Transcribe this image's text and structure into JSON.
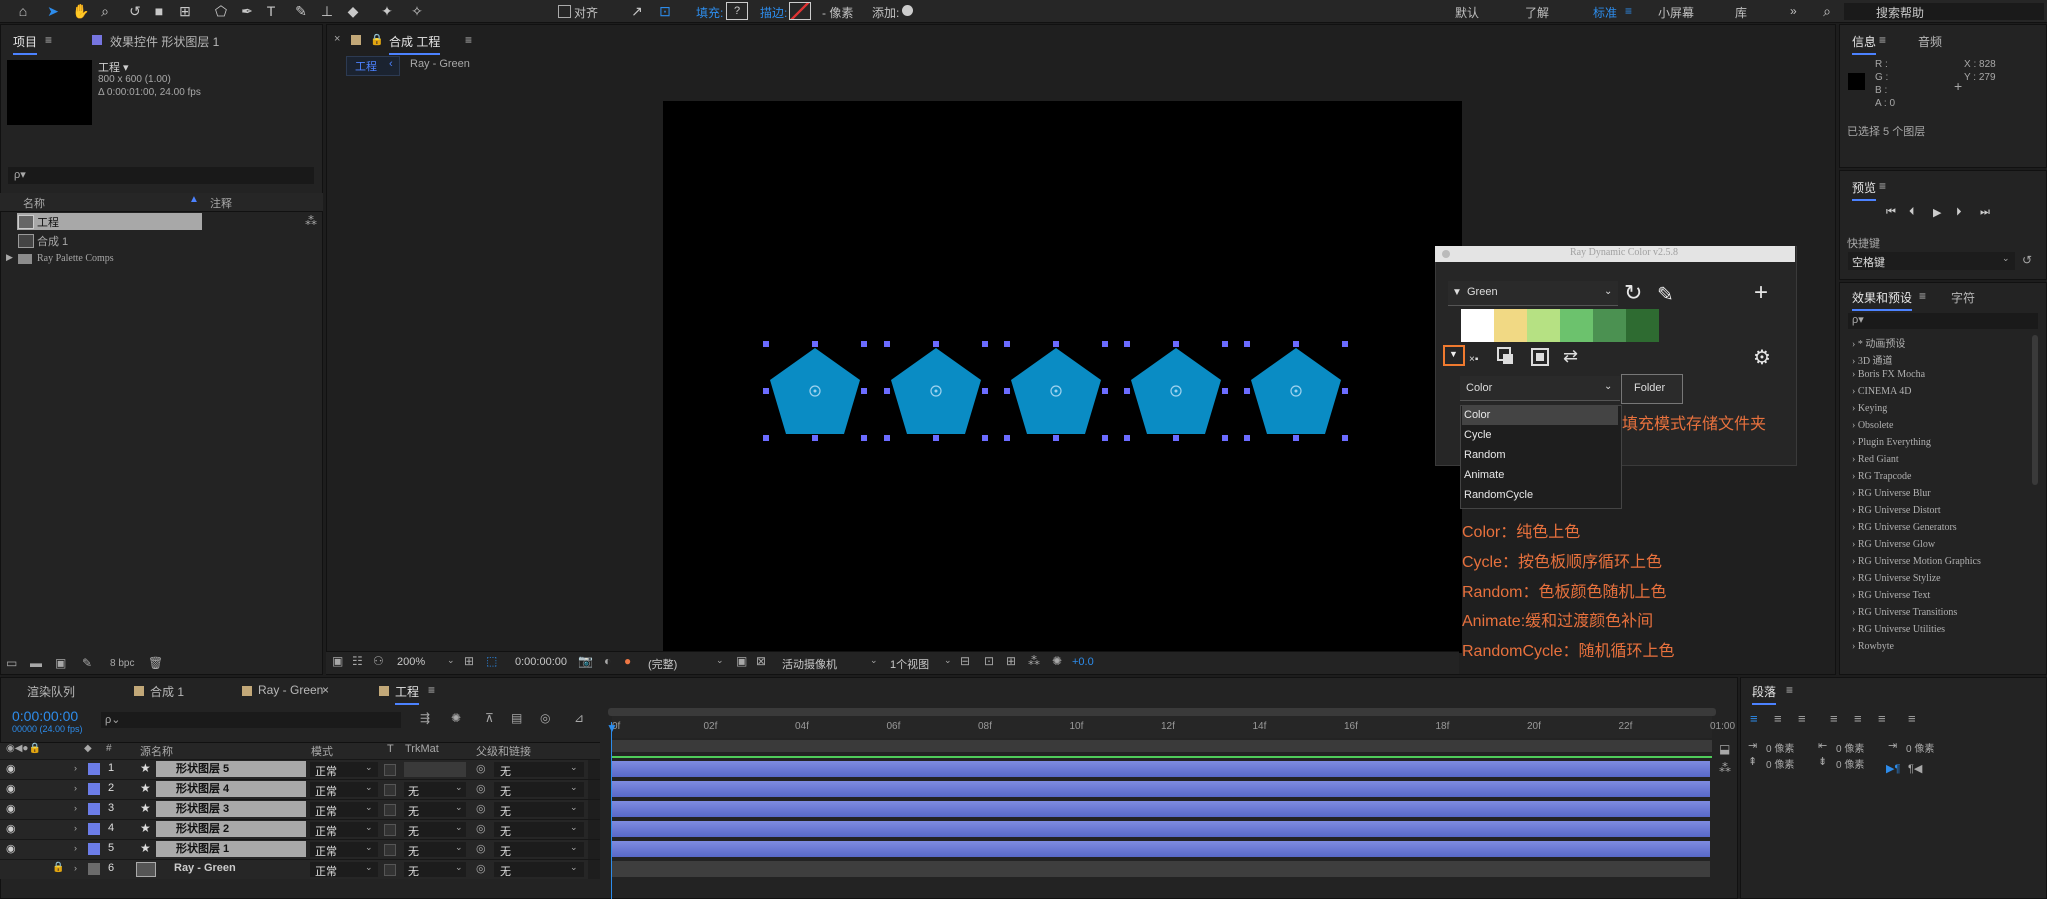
{
  "toolbar": {
    "align_label": "对齐",
    "fill_label": "填充:",
    "fill_value": "?",
    "stroke_label": "描边:",
    "stroke_unit": "- 像素",
    "add_label": "添加:",
    "workspaces": [
      "默认",
      "了解",
      "标准",
      "小屏幕",
      "库"
    ],
    "active_workspace": "标准",
    "search_help": "搜索帮助"
  },
  "project_panel": {
    "tab_project": "项目",
    "tab_effects": "效果控件 形状图层 1",
    "item_name": "工程 ▾",
    "item_size": "800 x 600 (1.00)",
    "item_duration": "Δ 0:00:01:00, 24.00 fps",
    "search_placeholder": "ρ▾",
    "col_name": "名称",
    "col_comment": "注释",
    "rows": [
      "工程",
      "合成 1",
      "Ray Palette Comps"
    ],
    "bpc": "8 bpc"
  },
  "comp_viewer": {
    "tab_label": "合成 工程",
    "breadcrumb_1": "工程",
    "breadcrumb_2": "Ray - Green",
    "zoom": "200%",
    "timecode": "0:00:00:00",
    "resolution": "(完整)",
    "camera": "活动摄像机",
    "views": "1个视图",
    "exposure": "+0.0"
  },
  "ray_panel": {
    "title": "Ray Dynamic Color v2.5.8",
    "palette_name": "Green",
    "swatch_colors": [
      "#ffffff",
      "#f1d984",
      "#b6e183",
      "#6cc26d",
      "#4b9151",
      "#2e6b31"
    ],
    "mode_selected": "Color",
    "folder_button": "Folder",
    "mode_options": [
      "Color",
      "Cycle",
      "Random",
      "Animate",
      "RandomCycle"
    ],
    "folder_annotation": "填充模式存储文件夹"
  },
  "annotations": [
    "Color：纯色上色",
    "Cycle：按色板顺序循环上色",
    "Random：色板颜色随机上色",
    "Animate:缓和过渡颜色补间",
    "RandomCycle：随机循环上色"
  ],
  "info_panel": {
    "tab_info": "信息",
    "tab_audio": "音频",
    "r": "R :",
    "g": "G :",
    "b": "B :",
    "a": "A : 0",
    "x": "X : 828",
    "y": "Y : 279",
    "status": "已选择 5 个图层"
  },
  "preview_panel": {
    "title": "预览",
    "shortcut_label": "快捷键",
    "shortcut_value": "空格键"
  },
  "effects_panel": {
    "tab_effects": "效果和预设",
    "tab_char": "字符",
    "search_placeholder": "ρ▾",
    "items": [
      "* 动画预设",
      "3D 通道",
      "Boris FX Mocha",
      "CINEMA 4D",
      "Keying",
      "Obsolete",
      "Plugin Everything",
      "Red Giant",
      "RG Trapcode",
      "RG Universe Blur",
      "RG Universe Distort",
      "RG Universe Generators",
      "RG Universe Glow",
      "RG Universe Motion Graphics",
      "RG Universe Stylize",
      "RG Universe Text",
      "RG Universe Transitions",
      "RG Universe Utilities",
      "Rowbyte"
    ]
  },
  "timeline": {
    "tabs": [
      "渲染队列",
      "合成 1",
      "Ray - Green",
      "工程"
    ],
    "timecode": "0:00:00:00",
    "fps": "00000 (24.00 fps)",
    "col_source": "源名称",
    "col_mode": "模式",
    "col_t": "T",
    "col_trkmat": "TrkMat",
    "col_parent": "父级和链接",
    "ruler": [
      "0f",
      "02f",
      "04f",
      "06f",
      "08f",
      "10f",
      "12f",
      "14f",
      "16f",
      "18f",
      "20f",
      "22f",
      "01:00"
    ],
    "layers": [
      {
        "num": "1",
        "name": "形状图层 5",
        "mode": "正常",
        "trk": "",
        "parent": "无"
      },
      {
        "num": "2",
        "name": "形状图层 4",
        "mode": "正常",
        "trk": "无",
        "parent": "无"
      },
      {
        "num": "3",
        "name": "形状图层 3",
        "mode": "正常",
        "trk": "无",
        "parent": "无"
      },
      {
        "num": "4",
        "name": "形状图层 2",
        "mode": "正常",
        "trk": "无",
        "parent": "无"
      },
      {
        "num": "5",
        "name": "形状图层 1",
        "mode": "正常",
        "trk": "无",
        "parent": "无"
      },
      {
        "num": "6",
        "name": "Ray - Green",
        "mode": "正常",
        "trk": "无",
        "parent": "无"
      }
    ]
  },
  "paragraph_panel": {
    "title": "段落",
    "px1": "0 像素",
    "px2": "0 像素",
    "px3": "0 像素",
    "px4": "0 像素",
    "px5": "0 像素"
  }
}
